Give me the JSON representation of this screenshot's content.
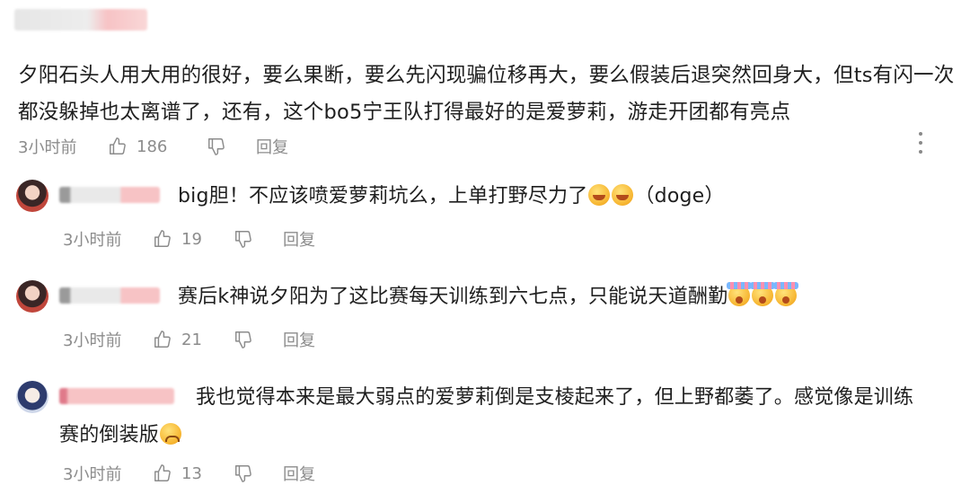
{
  "main_comment": {
    "text": "夕阳石头人用大用的很好，要么果断，要么先闪现骗位移再大，要么假装后退突然回身大，但ts有闪一次都没躲掉也太离谱了，还有，这个bo5宁王队打得最好的是爱萝莉，游走开团都有亮点",
    "time": "3小时前",
    "likes": "186",
    "reply_label": "回复"
  },
  "replies": [
    {
      "text": "big胆！不应该喷爱萝莉坑么，上单打野尽力了",
      "suffix": "（doge）",
      "time": "3小时前",
      "likes": "19",
      "reply_label": "回复"
    },
    {
      "text": "赛后k神说夕阳为了这比赛每天训练到六七点，只能说天道酬勤",
      "time": "3小时前",
      "likes": "21",
      "reply_label": "回复"
    },
    {
      "text_line1": "我也觉得本来是最大弱点的爱萝莉倒是支棱起来了，但上野都萎了。感觉像是训练",
      "text_line2": "赛的倒装版",
      "time": "3小时前",
      "likes": "13",
      "reply_label": "回复"
    }
  ],
  "icons": {
    "like": "thumbs-up-icon",
    "dislike": "thumbs-down-icon",
    "more": "more-vertical-icon"
  },
  "colors": {
    "meta_text": "#8c8c8c",
    "redaction_pink": "#f7c3c5"
  }
}
